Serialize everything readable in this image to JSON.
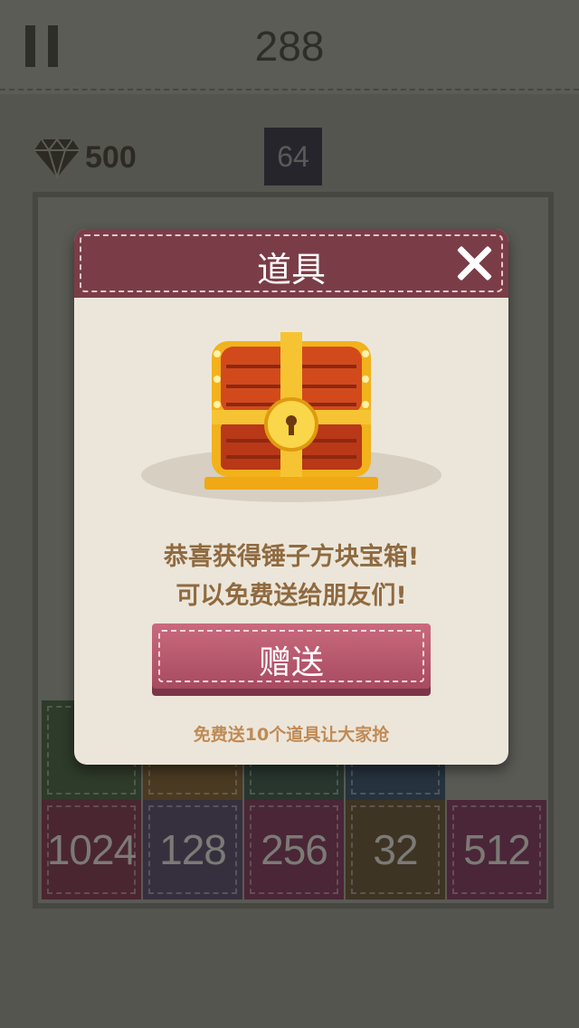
{
  "header": {
    "score": "288"
  },
  "status": {
    "gems": "500",
    "next_tile": "64"
  },
  "board": {
    "row_partial": [
      {
        "bg": "#2e3a2a",
        "value": ""
      },
      {
        "bg": "#4a3a22",
        "value": ""
      },
      {
        "bg": "#28362e",
        "value": ""
      },
      {
        "bg": "#26323e",
        "value": ""
      }
    ],
    "row_bottom": [
      {
        "bg": "#4a2630",
        "value": "1024"
      },
      {
        "bg": "#36303e",
        "value": "128"
      },
      {
        "bg": "#4a2636",
        "value": "256"
      },
      {
        "bg": "#3e3424",
        "value": "32"
      },
      {
        "bg": "#4a2638",
        "value": "512"
      }
    ]
  },
  "dialog": {
    "title": "道具",
    "message_line1": "恭喜获得锤子方块宝箱!",
    "message_line2": "可以免费送给朋友们!",
    "gift_button": "赠送",
    "footer": "免费送10个道具让大家抢"
  },
  "colors": {
    "header_bg": "#7a3d47",
    "button": "#b85670",
    "text_brown": "#8f6a40"
  }
}
